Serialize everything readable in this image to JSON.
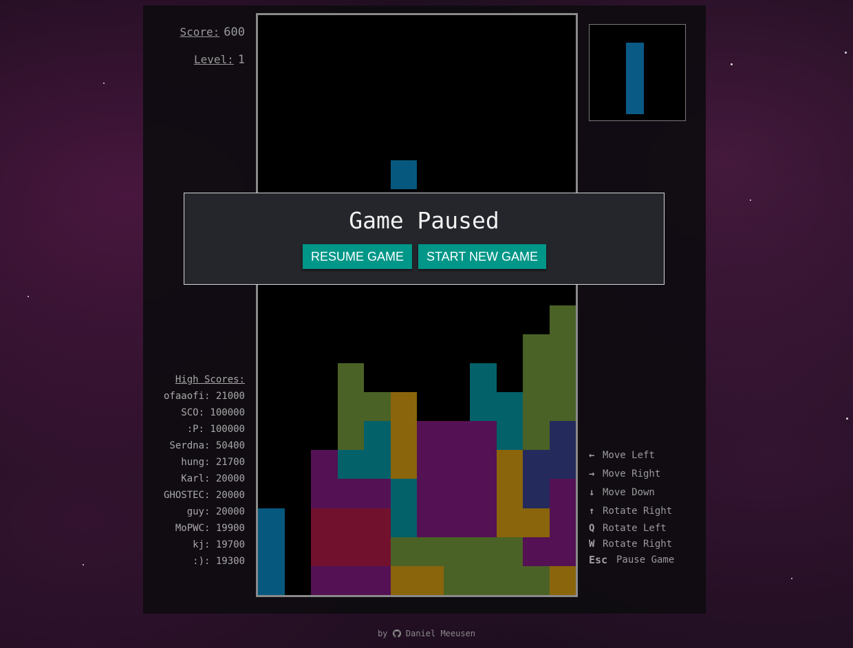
{
  "score": {
    "label": "Score:",
    "value": "600"
  },
  "level": {
    "label": "Level:",
    "value": "1"
  },
  "high_scores": {
    "title": "High Scores:",
    "entries": [
      "ofaaofi: 21000",
      "SCO: 100000",
      ":P: 100000",
      "Serdna: 50400",
      "hung: 21700",
      "Karl: 20000",
      "GHOSTEC: 20000",
      "guy: 20000",
      "MoPWC: 19900",
      "kj: 19700",
      ":): 19300"
    ]
  },
  "controls": [
    {
      "key": "←",
      "icon": "arrow-left-icon",
      "label": "Move Left"
    },
    {
      "key": "→",
      "icon": "arrow-right-icon",
      "label": "Move Right"
    },
    {
      "key": "↓",
      "icon": "arrow-down-icon",
      "label": "Move Down"
    },
    {
      "key": "↑",
      "icon": "arrow-up-icon",
      "label": "Rotate Right"
    },
    {
      "key": "Q",
      "icon": "q-key-icon",
      "label": "Rotate Left"
    },
    {
      "key": "W",
      "icon": "w-key-icon",
      "label": "Rotate Right"
    },
    {
      "key": "Esc",
      "icon": "esc-key-icon",
      "label": "Pause Game"
    }
  ],
  "pause_dialog": {
    "title": "Game Paused",
    "resume_label": "RESUME GAME",
    "new_game_label": "START NEW GAME"
  },
  "footer": {
    "by": "by",
    "author": "Daniel Meeusen",
    "icon": "github-icon"
  },
  "colors": {
    "I": "#07587e",
    "Z": "#4b6226",
    "T": "#036169",
    "O": "#8a650c",
    "S": "#541254",
    "J": "#252a5c",
    "L": "#72112e",
    "accent": "#009688"
  },
  "board": {
    "columns": 12,
    "rows": 20,
    "rows_grid": [
      "............",
      "............",
      "............",
      "............",
      "............",
      ".....I......",
      "............",
      "............",
      "............",
      "............",
      "...........Z",
      "..........ZZ",
      "...Z....T.ZZ",
      "...ZZO..TTZZ",
      "...ZTOSSSTZJ",
      "..STTOSSSOJJ",
      "..SSSTSSSOJS",
      "I.LLLTSSSOOS",
      "I.LLLZZZZZSS",
      "I.SSSOOZZZZO"
    ]
  },
  "next_piece": {
    "shape": "I",
    "orientation": "vertical"
  }
}
